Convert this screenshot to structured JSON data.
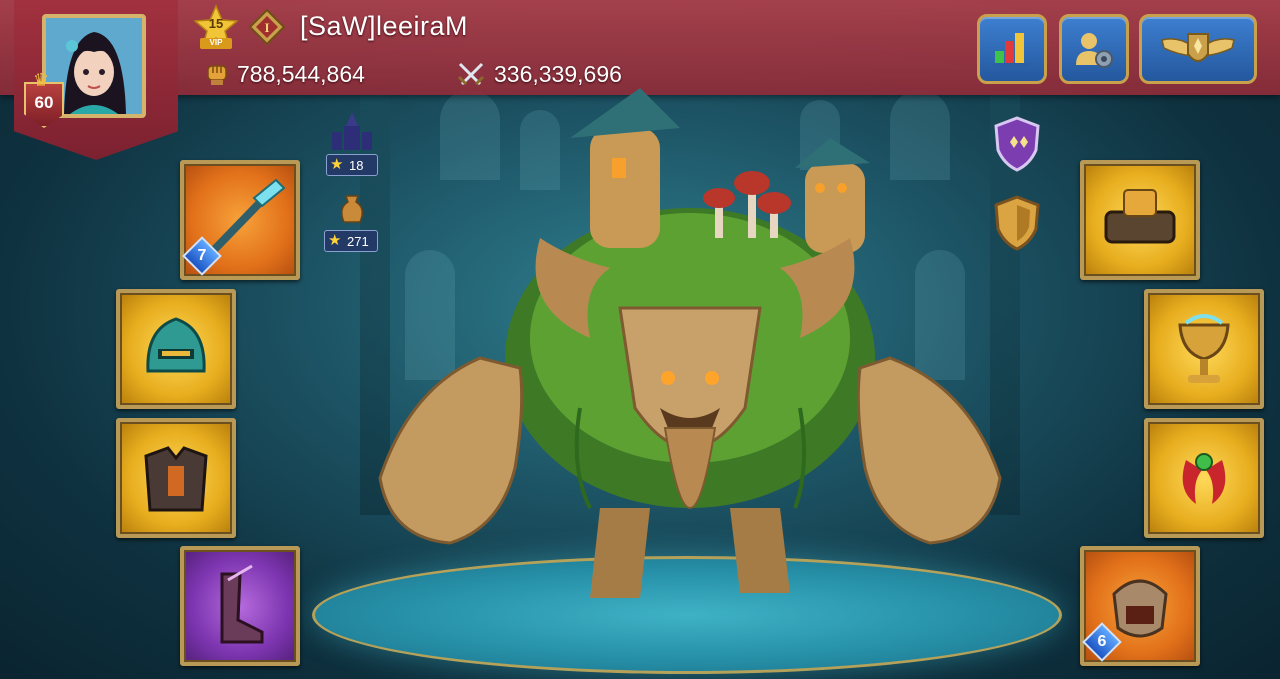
{
  "player": {
    "name": "[SaW]leeiraM",
    "level": "60",
    "vip_level": "15",
    "vip_label": "VIP",
    "power": "788,544,864",
    "troops_killed": "336,339,696"
  },
  "header_buttons": [
    {
      "name": "stats-button",
      "icon": "bar-chart-icon"
    },
    {
      "name": "account-settings-button",
      "icon": "user-gear-icon"
    },
    {
      "name": "rank-emblem-button",
      "icon": "winged-shield-icon"
    }
  ],
  "side_stats": {
    "castle_stars": "18",
    "vase_stars": "271"
  },
  "left_equipment": [
    {
      "slot": "weapon",
      "icon": "spear-icon",
      "rarity": "orange",
      "rank": "7"
    },
    {
      "slot": "helmet",
      "icon": "helmet-icon",
      "rarity": "gold",
      "rank": ""
    },
    {
      "slot": "armor",
      "icon": "armor-icon",
      "rarity": "gold",
      "rank": ""
    },
    {
      "slot": "boots",
      "icon": "boots-icon",
      "rarity": "purple",
      "rank": ""
    }
  ],
  "right_equipment": [
    {
      "slot": "off-hand",
      "icon": "shield-gear-icon",
      "rarity": "gold",
      "rank": ""
    },
    {
      "slot": "accessory-1",
      "icon": "chalice-icon",
      "rarity": "gold",
      "rank": ""
    },
    {
      "slot": "accessory-2",
      "icon": "claw-ring-icon",
      "rarity": "gold",
      "rank": ""
    },
    {
      "slot": "accessory-3",
      "icon": "mask-icon",
      "rarity": "orange",
      "rank": "6"
    }
  ],
  "colors": {
    "header": "#b0414c",
    "button_blue": "#3d7fd0",
    "frame_gold": "#b89a56"
  }
}
